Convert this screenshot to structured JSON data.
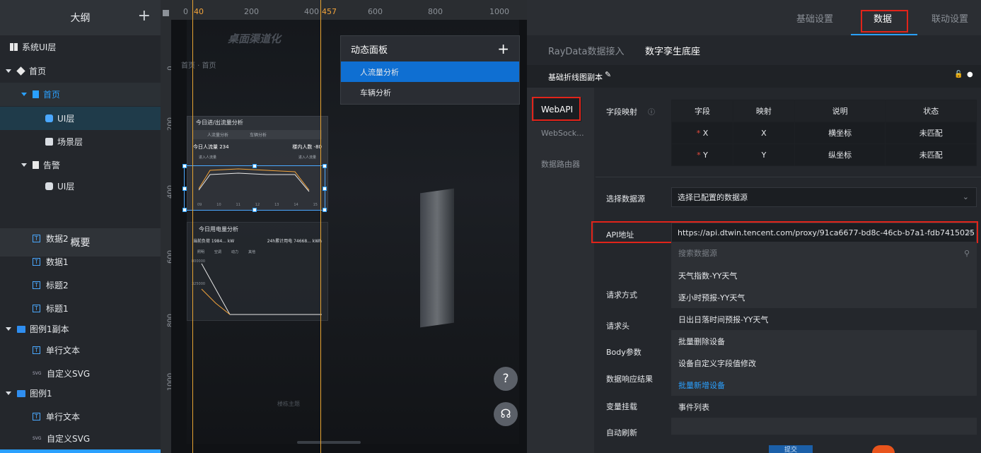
{
  "outline": {
    "title": "大纲",
    "add": "+",
    "items": [
      {
        "label": "系统UI层"
      },
      {
        "label": "首页"
      },
      {
        "label": "首页"
      },
      {
        "label": "UI层"
      },
      {
        "label": "场景层"
      },
      {
        "label": "告警"
      },
      {
        "label": "UI层"
      }
    ]
  },
  "overview": {
    "title": "概要",
    "items": [
      {
        "label": "数据2",
        "tag": "T"
      },
      {
        "label": "数据1",
        "tag": "T"
      },
      {
        "label": "标题2",
        "tag": "T"
      },
      {
        "label": "标题1",
        "tag": "T"
      },
      {
        "label": "图例1副本"
      },
      {
        "label": "单行文本",
        "tag": "T"
      },
      {
        "label": "自定义SVG",
        "tag": "SVG"
      },
      {
        "label": "图例1"
      },
      {
        "label": "单行文本",
        "tag": "T"
      },
      {
        "label": "自定义SVG",
        "tag": "SVG"
      }
    ]
  },
  "ruler": {
    "h": [
      "0",
      "40",
      "200",
      "400",
      "457",
      "600",
      "800",
      "1000"
    ],
    "v": [
      "0",
      "200",
      "400",
      "600",
      "800",
      "1000"
    ]
  },
  "canvas": {
    "title": "桌面渠道化",
    "breadcrumb": "首页 · 首页",
    "card1_title": "今日进/出流量分析",
    "card1_tab1": "人流量分析",
    "card1_tab2": "车辆分析",
    "card1_stat1": "今日人流量 234",
    "card1_stat2": "楼内人数 -80",
    "card1_legend1": "进入人流量",
    "card1_legend2": "进入人流量",
    "card2_title": "今日用电量分析",
    "card2_stat1": "当前负荷 1984... kW",
    "card2_stat2": "24h累计用电 74668... kWh",
    "card2_legend": [
      "照明",
      "空调",
      "动力",
      "其他"
    ],
    "card2_tick1": "800000",
    "card2_tick2": "325000",
    "x_ticks": [
      "09",
      "10",
      "11",
      "12",
      "13",
      "14",
      "15"
    ],
    "bottom_label": "楼栋主题"
  },
  "dynamic_panel": {
    "title": "动态面板",
    "add": "+",
    "items": [
      "人流量分析",
      "车辆分析"
    ]
  },
  "fab": {
    "help": "?",
    "support": "☊"
  },
  "right": {
    "tabs": [
      "基础设置",
      "数据",
      "联动设置"
    ],
    "subtabs": [
      "RayData数据接入",
      "数字孪生底座"
    ],
    "component_name": "基础折线图副本",
    "sources": [
      "WebAPI",
      "WebSock...",
      "数据路由器"
    ],
    "field_map_label": "字段映射",
    "table_headers": [
      "字段",
      "映射",
      "说明",
      "状态"
    ],
    "table_rows": [
      {
        "field": "X",
        "map": "X",
        "desc": "横坐标",
        "status": "未匹配"
      },
      {
        "field": "Y",
        "map": "Y",
        "desc": "纵坐标",
        "status": "未匹配"
      }
    ],
    "datasource_label": "选择数据源",
    "datasource_value": "选择已配置的数据源",
    "api_label": "API地址",
    "api_value": "https://api.dtwin.tencent.com/proxy/91ca6677-bd8c-46cb-b7a1-fdb7415025",
    "search_placeholder": "搜索数据源",
    "dropdown_options": [
      "天气指数-YY天气",
      "逐小时预报-YY天气",
      "日出日落时间预报-YY天气",
      "批量删除设备",
      "设备自定义字段值修改",
      "批量新增设备",
      "事件列表"
    ],
    "row_labels": [
      "请求方式",
      "请求头",
      "Body参数",
      "数据响应结果",
      "变量挂载",
      "自动刷新"
    ],
    "submit": "提交"
  },
  "colors": {
    "accent": "#2aa0ff",
    "highlight": "#e1241a",
    "guide": "#e6a332",
    "selected": "#0f6fd2"
  }
}
